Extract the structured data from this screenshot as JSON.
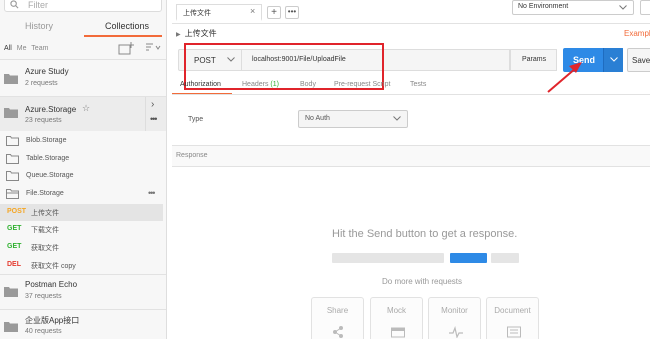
{
  "sidebar": {
    "filter_placeholder": "Filter",
    "tabs": [
      {
        "label": "History"
      },
      {
        "label": "Collections"
      }
    ],
    "subtabs": [
      "All",
      "Me",
      "Team"
    ],
    "collections": [
      {
        "name": "Azure Study",
        "count": "2 requests"
      },
      {
        "name": "Azure.Storage",
        "count": "23 requests"
      },
      {
        "name": "Postman Echo",
        "count": "37 requests"
      },
      {
        "name": "企业版App接口",
        "count": "40 requests"
      }
    ],
    "folders": [
      "Blob.Storage",
      "Table.Storage",
      "Queue.Storage",
      "File.Storage"
    ],
    "requests": [
      {
        "method": "POST",
        "name": "上传文件"
      },
      {
        "method": "GET",
        "name": "下载文件"
      },
      {
        "method": "GET",
        "name": "获取文件"
      },
      {
        "method": "DEL",
        "name": "获取文件 copy"
      }
    ]
  },
  "main": {
    "tab_title": "上传文件",
    "environment": "No Environment",
    "breadcrumb": "上传文件",
    "examples_label": "Example",
    "method": "POST",
    "url": "localhost:9001/File/UploadFile",
    "params_label": "Params",
    "send_label": "Send",
    "save_label": "Save",
    "request_tabs": [
      {
        "label": "Authorization"
      },
      {
        "label": "Headers",
        "count": "(1)"
      },
      {
        "label": "Body"
      },
      {
        "label": "Pre-request Script"
      },
      {
        "label": "Tests"
      }
    ],
    "auth_type_label": "Type",
    "auth_type_value": "No Auth",
    "response_label": "Response",
    "empty_message": "Hit the Send button to get a response.",
    "do_more": "Do more with requests",
    "cards": [
      "Share",
      "Mock",
      "Monitor",
      "Document"
    ]
  },
  "colors": {
    "accent": "#f26b3a",
    "send_button": "#2e8ae6",
    "highlight": "#e0242b",
    "post": "#f5a623",
    "get": "#2fb12f",
    "delete": "#e53a2f"
  }
}
